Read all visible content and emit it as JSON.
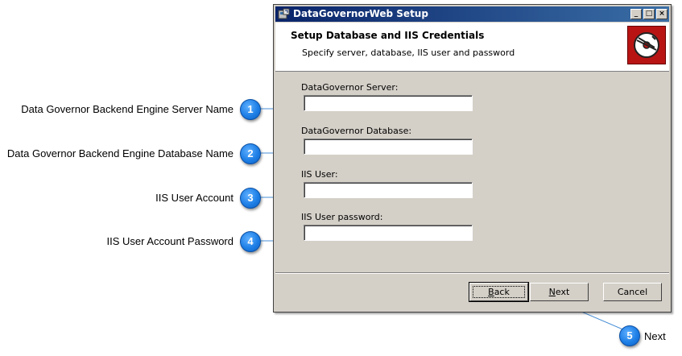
{
  "window": {
    "title": "DataGovernorWeb Setup",
    "minimize_glyph": "_",
    "maximize_glyph": "□",
    "close_glyph": "×"
  },
  "header": {
    "title": "Setup Database and IIS Credentials",
    "subtitle": "Specify server, database, IIS user and password"
  },
  "fields": [
    {
      "label": "DataGovernor Server:",
      "value": ""
    },
    {
      "label": "DataGovernor Database:",
      "value": ""
    },
    {
      "label": "IIS User:",
      "value": ""
    },
    {
      "label": "IIS User password:",
      "value": ""
    }
  ],
  "buttons": {
    "back_mn": "B",
    "back_rest": "ack",
    "next_mn": "N",
    "next_rest": "ext",
    "cancel": "Cancel"
  },
  "annotations": [
    {
      "number": "1",
      "text": "Data Governor Backend Engine Server Name"
    },
    {
      "number": "2",
      "text": "Data Governor Backend Engine Database Name"
    },
    {
      "number": "3",
      "text": "IIS User Account"
    },
    {
      "number": "4",
      "text": "IIS User Account Password"
    },
    {
      "number": "5",
      "text": "Next"
    }
  ],
  "colors": {
    "titlebar": "#0a246a",
    "badge": "#1e7fe6",
    "dialog_bg": "#d4d0c8",
    "logo": "#b81414"
  }
}
